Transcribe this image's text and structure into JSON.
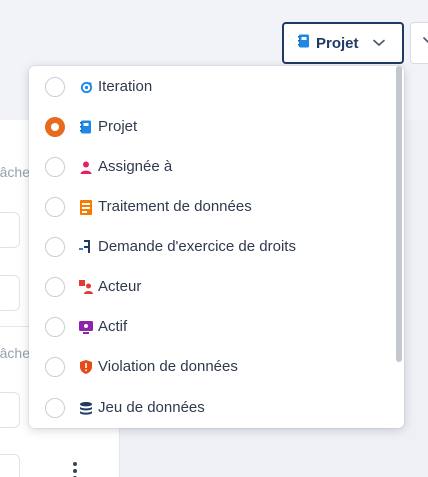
{
  "selector": {
    "label": "Projet",
    "icon": "notebook-icon",
    "chevron_icon": "chevron-down-icon"
  },
  "background": {
    "section_label_1": "Tâche",
    "section_label_2": "Tâche"
  },
  "dropdown": {
    "options": [
      {
        "label": "Iteration",
        "icon": "iteration-icon",
        "icon_color": "#1e88e5",
        "checked": false
      },
      {
        "label": "Projet",
        "icon": "notebook-icon",
        "icon_color": "#1e88e5",
        "checked": true
      },
      {
        "label": "Assignée à",
        "icon": "person-icon",
        "icon_color": "#e91e63",
        "checked": false
      },
      {
        "label": "Traitement de données",
        "icon": "data-processing-icon",
        "icon_color": "#f57c00",
        "checked": false
      },
      {
        "label": "Demande d'exercice de droits",
        "icon": "rights-request-icon",
        "icon_color": "#1f3a63",
        "checked": false
      },
      {
        "label": "Acteur",
        "icon": "actor-icon",
        "icon_color": "#e53935",
        "checked": false
      },
      {
        "label": "Actif",
        "icon": "asset-icon",
        "icon_color": "#8e24aa",
        "checked": false
      },
      {
        "label": "Violation de données",
        "icon": "shield-alert-icon",
        "icon_color": "#e64a19",
        "checked": false
      },
      {
        "label": "Jeu de données",
        "icon": "database-icon",
        "icon_color": "#1f3a63",
        "checked": false
      }
    ]
  },
  "colors": {
    "accent": "#e86a1e",
    "brand": "#1f3a63"
  }
}
